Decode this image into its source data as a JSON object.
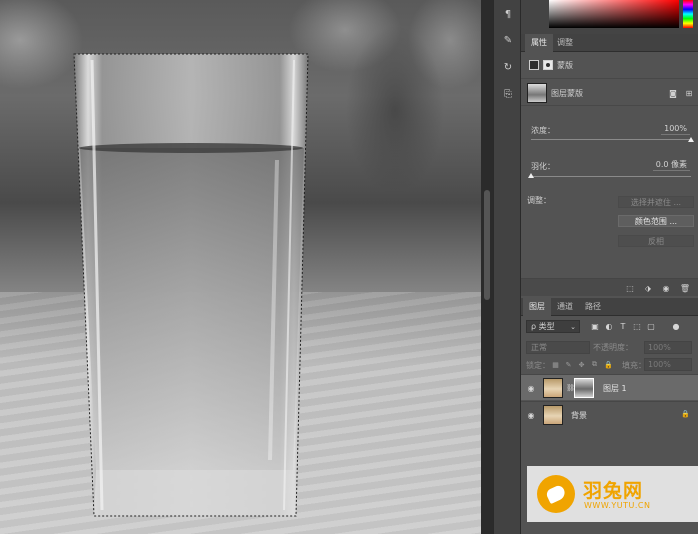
{
  "canvas": {
    "description_icon": "photo-glass-of-water",
    "selection": "marching-ants"
  },
  "toolstrip": {
    "icons": [
      "paragraph-icon",
      "brush-settings-icon",
      "history-icon",
      "clone-source-icon"
    ]
  },
  "properties": {
    "tabs": [
      {
        "label": "属性",
        "active": true
      },
      {
        "label": "调整",
        "active": false
      }
    ],
    "header_label": "蒙版",
    "mask_type_label": "图层蒙版",
    "density": {
      "label": "浓度：",
      "value": "100%",
      "level": 1.0
    },
    "feather": {
      "label": "羽化：",
      "value": "0.0 像素",
      "level": 0.0
    },
    "adjust_label": "调整：",
    "buttons": {
      "select_and_mask": "选择并遮住 ...",
      "color_range": "颜色范围 ...",
      "invert": "反相"
    }
  },
  "layers": {
    "tabs": [
      {
        "label": "图层",
        "active": true
      },
      {
        "label": "通道",
        "active": false
      },
      {
        "label": "路径",
        "active": false
      }
    ],
    "filter_label": "ρ 类型",
    "blend_mode": "正常",
    "opacity_label": "不透明度：",
    "opacity_value": "100%",
    "lock_label": "锁定：",
    "fill_label": "填充：",
    "fill_value": "100%",
    "items": [
      {
        "name": "图层 1",
        "selected": true,
        "has_mask": true,
        "locked": false
      },
      {
        "name": "背景",
        "selected": false,
        "has_mask": false,
        "locked": true
      }
    ]
  },
  "watermark": {
    "name": "羽兔网",
    "url": "WWW.YUTU.CN",
    "color": "#f0a400"
  }
}
